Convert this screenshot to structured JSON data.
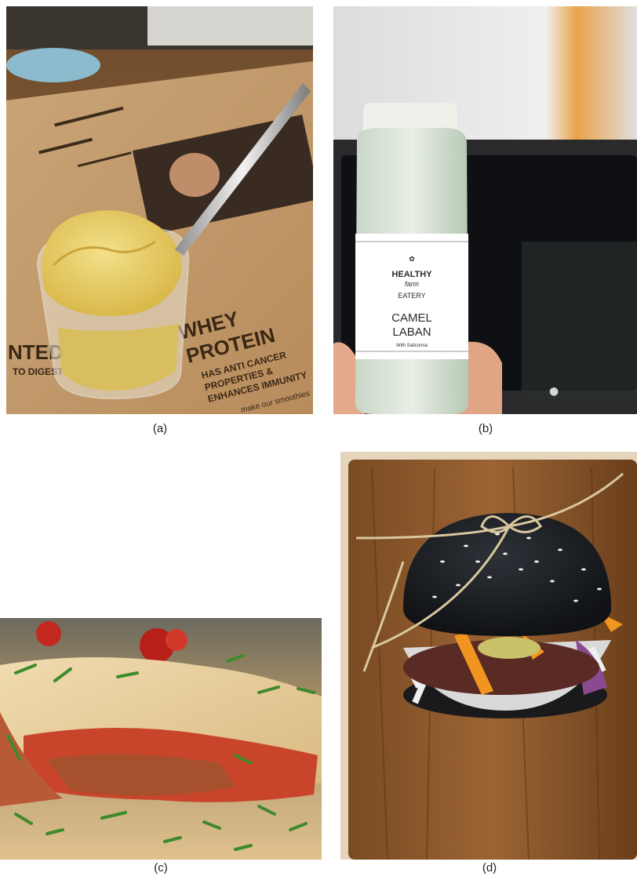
{
  "figure": {
    "panels": [
      {
        "caption": "(a)",
        "subject": "ice-cream-cup",
        "placemat_text": {
          "line1": "WHEY",
          "line2": "PROTEIN",
          "line3": "HAS ANTI CANCER",
          "line4": "PROPERTIES &",
          "line5": "ENHANCES IMMUNITY",
          "left1": "NTED",
          "left2": "TO DIGEST",
          "small": "make our smoothies"
        }
      },
      {
        "caption": "(b)",
        "subject": "camel-laban-bottle",
        "label": {
          "brand_top": "HEALTHY",
          "brand_script": "farm",
          "brand_bottom": "EATERY",
          "product_line1": "CAMEL",
          "product_line2": "LABAN",
          "subtitle": "With Salicornia"
        }
      },
      {
        "caption": "(c)",
        "subject": "lasagna-plate"
      },
      {
        "caption": "(d)",
        "subject": "black-bun-burger"
      }
    ],
    "colors": {
      "cardboard": "#c39a6b",
      "ice_cream": "#e8d06a",
      "wood": "#8a5a2e",
      "bun": "#1c1f24"
    }
  }
}
